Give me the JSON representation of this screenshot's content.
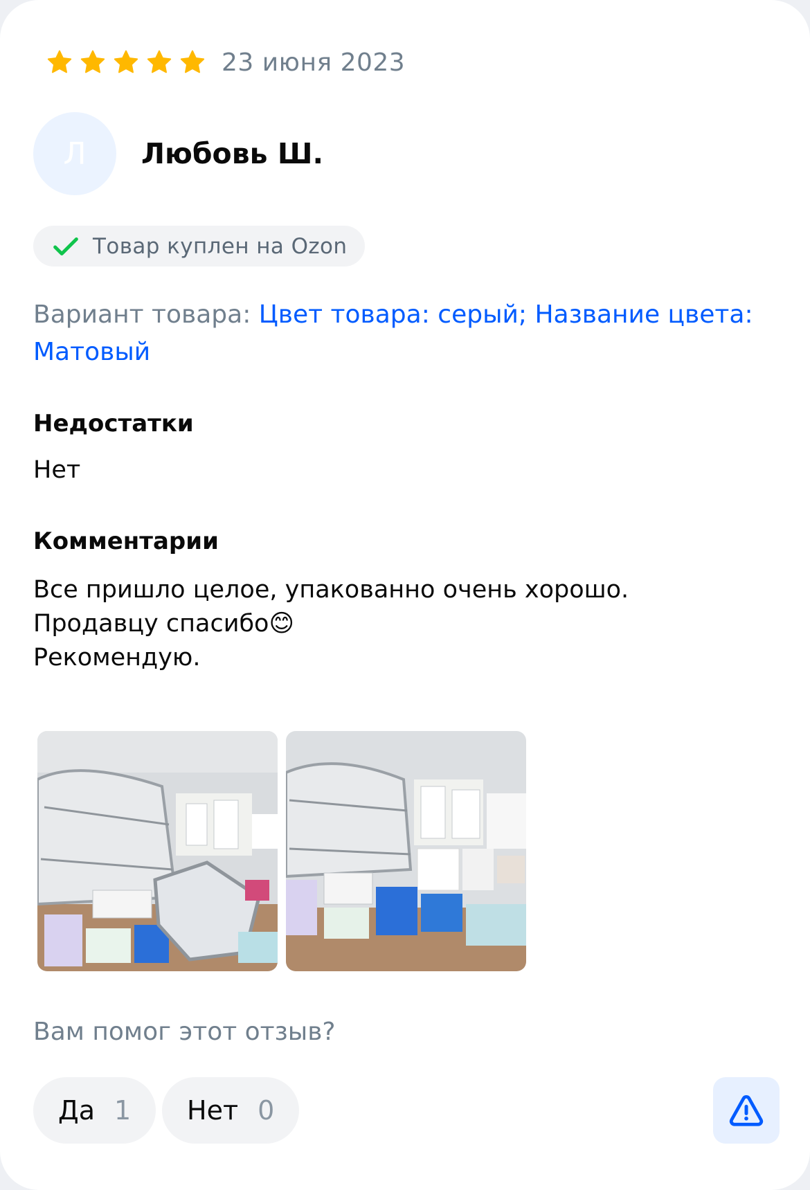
{
  "review": {
    "rating": 5,
    "rating_max": 5,
    "date": "23 июня 2023",
    "author": {
      "initial": "Л",
      "name": "Любовь Ш."
    },
    "purchase_badge": "Товар куплен на Ozon",
    "variant_label": "Вариант товара:",
    "variant_value_line1": "Цвет товара: серый; Название цвета:",
    "variant_value_line2": "Матовый",
    "cons_title": "Недостатки",
    "cons_text": "Нет",
    "comments_title": "Комментарии",
    "comment_lines": [
      "Все пришло целое, упакованно очень хорошо.",
      "Продавцу спасибо😊",
      "Рекомендую."
    ],
    "photo_count": 2,
    "helpful_question": "Вам помог этот отзыв?",
    "vote_yes_label": "Да",
    "vote_yes_count": "1",
    "vote_no_label": "Нет",
    "vote_no_count": "0"
  },
  "icons": {
    "star": "star-icon",
    "check": "check-icon",
    "report": "warning-triangle-icon"
  },
  "colors": {
    "star": "#ffb800",
    "check": "#10c44c",
    "link": "#005bff",
    "muted": "#707f8d",
    "report_bg": "#e7f0ff"
  }
}
